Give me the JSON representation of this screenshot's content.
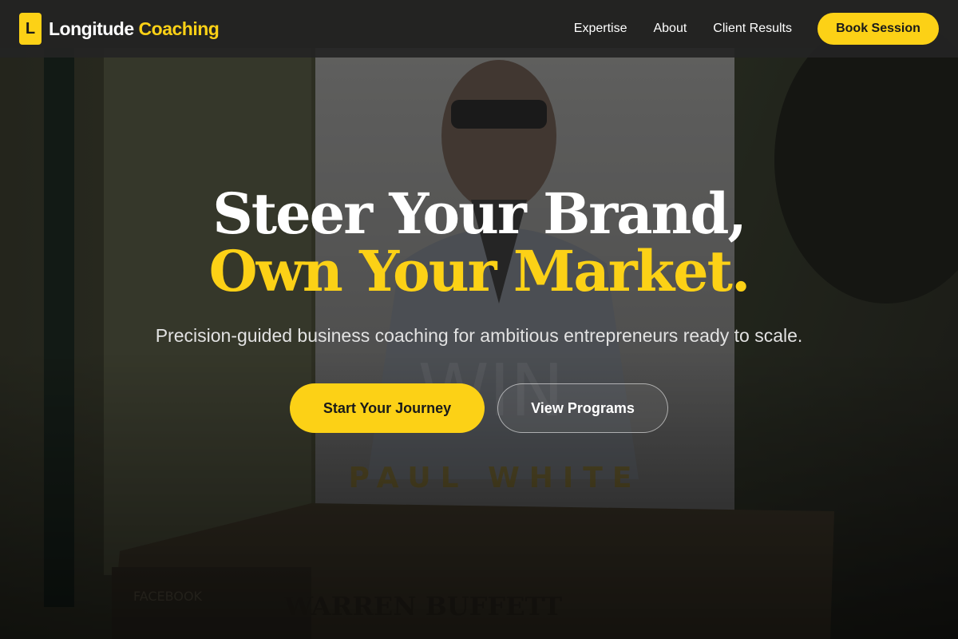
{
  "colors": {
    "accent": "#fcd116",
    "nav_background": "#242424",
    "text_primary": "#ffffff",
    "text_secondary": "#e2e2e2"
  },
  "navbar": {
    "logo_letter": "L",
    "brand_primary": "Longitude",
    "brand_accent": "Coaching",
    "links": [
      "Expertise",
      "About",
      "Client Results"
    ],
    "cta_label": "Book Session"
  },
  "hero": {
    "headline_line1": "Steer Your Brand,",
    "headline_line2": "Own Your Market.",
    "subtitle": "Precision-guided business coaching for ambitious entrepreneurs ready to scale.",
    "primary_cta": "Start Your Journey",
    "secondary_cta": "View Programs",
    "background_image": {
      "cover_title": "PLAY TO WIN",
      "cover_author": "PAUL WHITE",
      "book_spines": [
        "FACEBOOK",
        "WARREN BUFFETT"
      ]
    }
  }
}
